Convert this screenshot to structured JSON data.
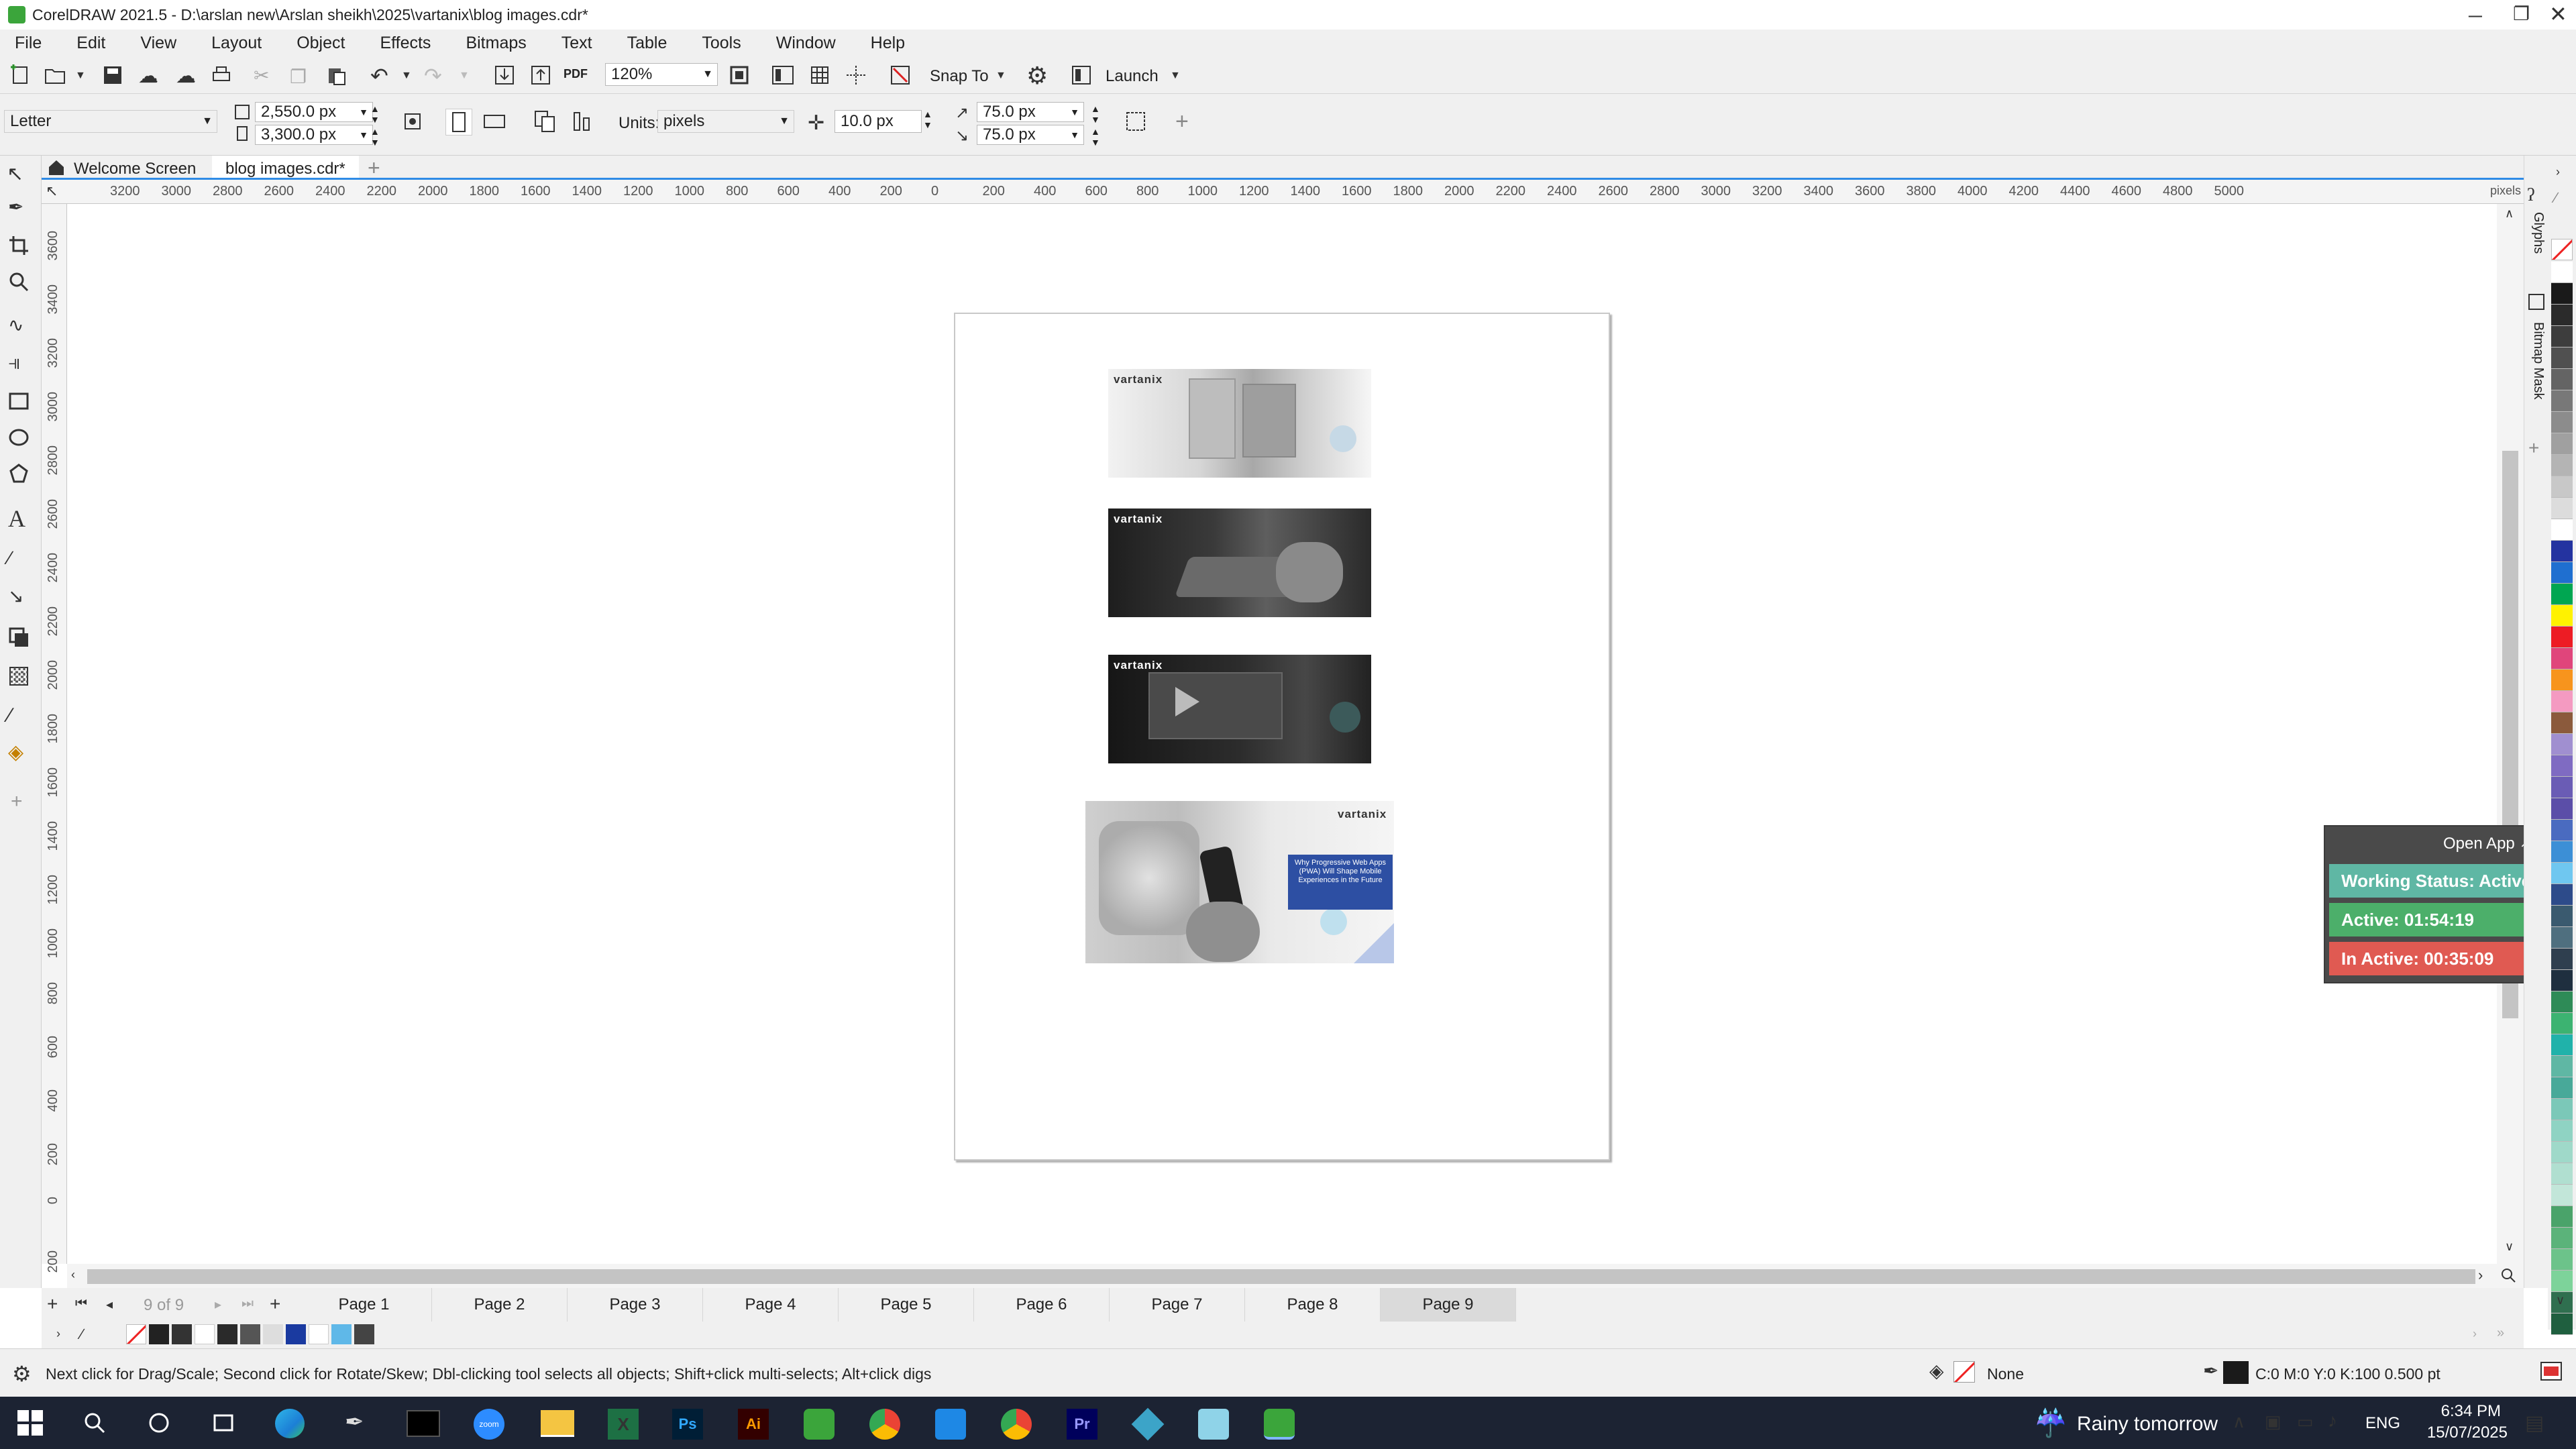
{
  "window": {
    "title": "CorelDRAW 2021.5 - D:\\arslan new\\Arslan sheikh\\2025\\vartanix\\blog images.cdr*"
  },
  "menu": [
    "File",
    "Edit",
    "View",
    "Layout",
    "Object",
    "Effects",
    "Bitmaps",
    "Text",
    "Table",
    "Tools",
    "Window",
    "Help"
  ],
  "toolbar": {
    "zoom": "120%",
    "snap_to": "Snap To",
    "launch": "Launch",
    "pdf": "PDF"
  },
  "properties": {
    "page_size": "Letter",
    "width": "2,550.0 px",
    "height": "3,300.0 px",
    "units_label": "Units:",
    "units": "pixels",
    "nudge": "10.0 px",
    "dup_x": "75.0 px",
    "dup_y": "75.0 px"
  },
  "doc_tabs": {
    "welcome": "Welcome Screen",
    "doc": "blog images.cdr*"
  },
  "ruler": {
    "h": [
      "3200",
      "3000",
      "2800",
      "2600",
      "2400",
      "2200",
      "2000",
      "1800",
      "1600",
      "1400",
      "1200",
      "1000",
      "800",
      "600",
      "400",
      "200",
      "0",
      "200",
      "400",
      "600",
      "800",
      "1000",
      "1200",
      "1400",
      "1600",
      "1800",
      "2000",
      "2200",
      "2400",
      "2600",
      "2800",
      "3000",
      "3200",
      "3400",
      "3600",
      "3800",
      "4000",
      "4200",
      "4400",
      "4600",
      "4800",
      "5000"
    ],
    "unit": "pixels",
    "v": [
      "3600",
      "3400",
      "3200",
      "3000",
      "2800",
      "2600",
      "2400",
      "2200",
      "2000",
      "1800",
      "1600",
      "1400",
      "1200",
      "1000",
      "800",
      "600",
      "400",
      "200",
      "0",
      "200"
    ]
  },
  "images": [
    {
      "logo": "vartanix"
    },
    {
      "logo": "vartanix"
    },
    {
      "logo": "vartanix"
    },
    {
      "logo": "vartanix",
      "caption": "Why Progressive Web Apps (PWA) Will Shape Mobile Experiences in the Future"
    }
  ],
  "pages": {
    "counter": "9 of 9",
    "tabs": [
      "Page 1",
      "Page 2",
      "Page 3",
      "Page 4",
      "Page 5",
      "Page 6",
      "Page 7",
      "Page 8",
      "Page 9"
    ],
    "active": "Page 9"
  },
  "status": {
    "hint": "Next click for Drag/Scale; Second click for Rotate/Skew; Dbl-clicking tool selects all objects; Shift+click multi-selects; Alt+click digs",
    "fill": "None",
    "outline": "C:0 M:0 Y:0 K:100  0.500 pt"
  },
  "dockers": [
    "Glyphs",
    "Bitmap Mask"
  ],
  "widget": {
    "open": "Open App",
    "status": "Working Status: Active",
    "active": "Active: 01:54:19",
    "inactive": "In Active: 00:35:09"
  },
  "taskbar": {
    "weather": "Rainy tomorrow",
    "lang": "ENG",
    "time": "6:34 PM",
    "date": "15/07/2025",
    "apps": [
      "file-explorer-icon",
      "edge-icon",
      "cortana-icon",
      "task-view-icon",
      "pen-icon",
      "terminal-icon",
      "zoom-icon",
      "folder-icon",
      "excel-icon",
      "photoshop-icon",
      "illustrator-icon",
      "coreldraw-icon",
      "chrome-icon",
      "vscode-icon",
      "chrome-alt-icon",
      "premiere-icon",
      "app-icon",
      "app2-icon",
      "coreldraw-active-icon"
    ]
  },
  "colors": {
    "accent": "#2f8be6",
    "active_green": "#4caf6a",
    "inactive_red": "#e05a52",
    "status_teal": "#5fb7a4",
    "widget_dark": "#4a4a4a",
    "palette": [
      "#ffffff",
      "#1a1a1a",
      "#2b2b2b",
      "#3d3d3d",
      "#505050",
      "#646464",
      "#787878",
      "#8c8c8c",
      "#a0a0a0",
      "#b4b4b4",
      "#c8c8c8",
      "#dcdcdc",
      "#ffffff",
      "#2433a0",
      "#1f6fd0",
      "#00a651",
      "#fff200",
      "#ed1c24",
      "#e0457b",
      "#f7941d",
      "#f49ac1",
      "#8b5a3c",
      "#a08fd0",
      "#7f6bc2",
      "#6a5cb5",
      "#5b4ea8",
      "#4a6bc0",
      "#3c8fd6",
      "#6fc7f0",
      "#2d4b8a",
      "#3a5a6f",
      "#4f6f7f",
      "#2f3f4f",
      "#1f2f3f",
      "#2e8b57",
      "#3cb371",
      "#20b2aa",
      "#5fb7a4",
      "#48a999",
      "#7bc8b8",
      "#8fd3c3",
      "#9fd9c9",
      "#b0dfd0",
      "#c2e6d9",
      "#4aa36a",
      "#5bb37a",
      "#6cc38a",
      "#7dd39a",
      "#2f6f4f",
      "#1f5f3f"
    ]
  }
}
